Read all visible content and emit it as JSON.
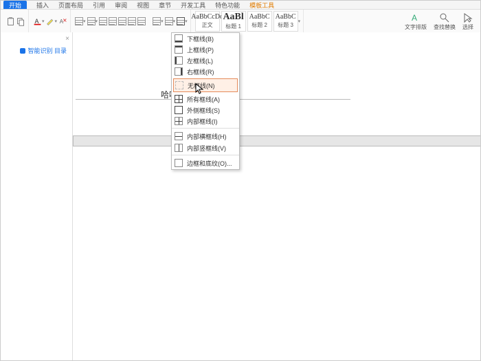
{
  "menubar": {
    "start": "开始",
    "items": [
      "插入",
      "页面布局",
      "引用",
      "审阅",
      "视图",
      "章节",
      "开发工具",
      "特色功能",
      "模板工具"
    ]
  },
  "ribbon": {
    "styles": [
      {
        "preview": "AaBbCcDd",
        "label": "正文"
      },
      {
        "preview": "AaBl",
        "label": "标题 1"
      },
      {
        "preview": "AaBbC",
        "label": "标题 2"
      },
      {
        "preview": "AaBbC",
        "label": "标题 3"
      }
    ],
    "right": {
      "wrap": "文字排版",
      "findreplace": "查找替换",
      "select": "选择"
    }
  },
  "left_panel": {
    "toc": "智能识别 目录"
  },
  "document": {
    "text": "哈哈哈哈"
  },
  "border_menu": {
    "items": [
      {
        "key": "bottom",
        "label": "下框线(B)"
      },
      {
        "key": "top",
        "label": "上框线(P)"
      },
      {
        "key": "left",
        "label": "左框线(L)"
      },
      {
        "key": "right",
        "label": "右框线(R)"
      },
      {
        "key": "none",
        "label": "无框线(N)",
        "hl": true,
        "sep": true
      },
      {
        "key": "all",
        "label": "所有框线(A)"
      },
      {
        "key": "outer",
        "label": "外侧框线(S)"
      },
      {
        "key": "inner",
        "label": "内部框线(I)"
      },
      {
        "key": "ih",
        "label": "内部横框线(H)",
        "sep": true
      },
      {
        "key": "iv",
        "label": "内部竖框线(V)"
      },
      {
        "key": "more",
        "label": "边框和底纹(O)...",
        "sep": true
      }
    ]
  }
}
